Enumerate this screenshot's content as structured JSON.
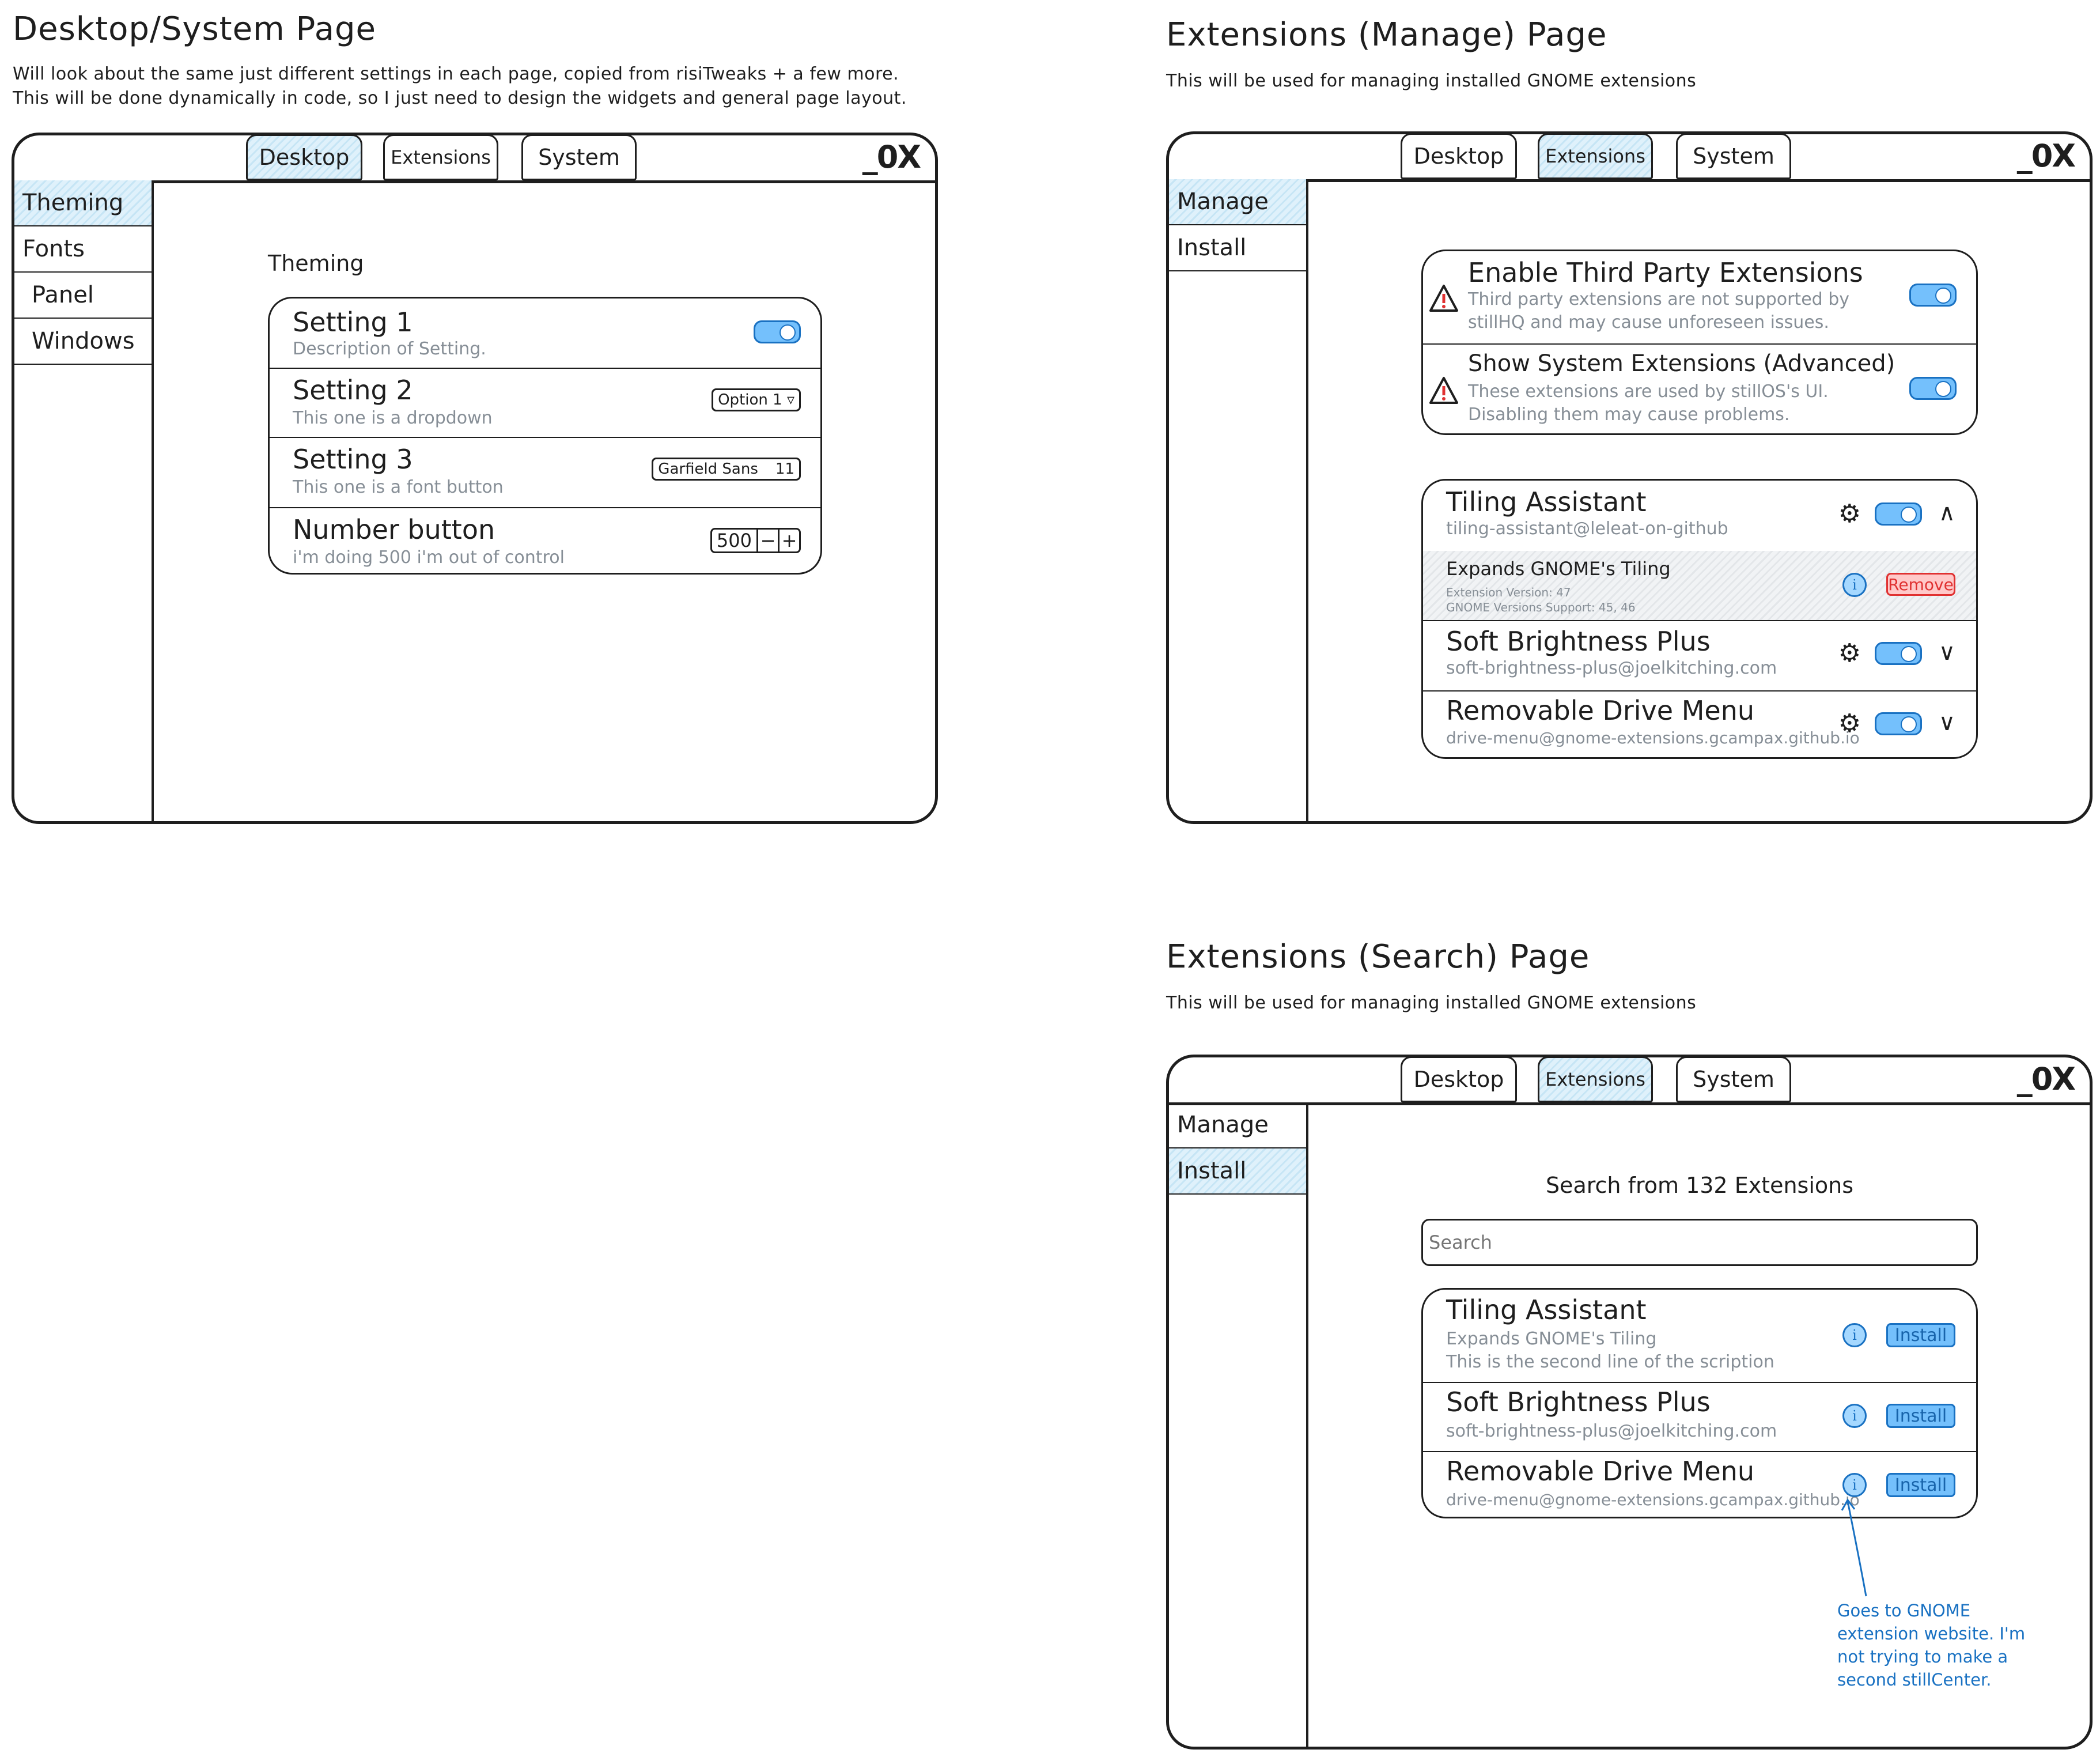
{
  "desktop": {
    "title": "Desktop/System Page",
    "desc1": "Will look about the same just different settings in each page, copied from risiTweaks + a few more.",
    "desc2": "This will be done dynamically in code, so I just need to design the widgets and general page layout.",
    "tabs": [
      "Desktop",
      "Extensions",
      "System"
    ],
    "window_controls": "_0X",
    "sidebar": [
      "Theming",
      "Fonts",
      "Panel",
      "Windows"
    ],
    "section_label": "Theming",
    "settings": [
      {
        "title": "Setting 1",
        "subtitle": "Description of Setting."
      },
      {
        "title": "Setting 2",
        "subtitle": "This one is a dropdown",
        "control": "Option 1 ▿"
      },
      {
        "title": "Setting 3",
        "subtitle": "This one is a font button",
        "font": "Garfield Sans",
        "size": "11"
      },
      {
        "title": "Number button",
        "subtitle": "i'm doing 500 i'm out of control",
        "value": "500",
        "minus": "−",
        "plus": "+"
      }
    ]
  },
  "manage": {
    "title": "Extensions (Manage) Page",
    "desc": "This will be used for managing installed GNOME extensions",
    "tabs": [
      "Desktop",
      "Extensions",
      "System"
    ],
    "window_controls": "_0X",
    "sidebar": [
      "Manage",
      "Install"
    ],
    "warnings": [
      {
        "title": "Enable Third Party Extensions",
        "line1": "Third party extensions are not supported by",
        "line2": "stillHQ and may cause unforeseen issues."
      },
      {
        "title": "Show System Extensions (Advanced)",
        "line1": "These extensions are used by stillOS's UI.",
        "line2": "Disabling them may cause problems."
      }
    ],
    "extensions": [
      {
        "name": "Tiling Assistant",
        "id": "tiling-assistant@leleat-on-github",
        "chevron": "∧"
      },
      {
        "name": "Soft Brightness Plus",
        "id": "soft-brightness-plus@joelkitching.com",
        "chevron": "∨"
      },
      {
        "name": "Removable Drive Menu",
        "id": "drive-menu@gnome-extensions.gcampax.github.io",
        "chevron": "∨"
      }
    ],
    "expanded": {
      "summary": "Expands GNOME's Tiling",
      "version": "Extension Version: 47",
      "support": "GNOME Versions Support: 45, 46",
      "remove": "Remove",
      "info": "i"
    }
  },
  "search": {
    "title": "Extensions (Search) Page",
    "desc": "This will be used for managing installed GNOME extensions",
    "tabs": [
      "Desktop",
      "Extensions",
      "System"
    ],
    "window_controls": "_0X",
    "sidebar": [
      "Manage",
      "Install"
    ],
    "heading": "Search from 132 Extensions",
    "search_placeholder": "Search",
    "results": [
      {
        "name": "Tiling Assistant",
        "line1": "Expands GNOME's Tiling",
        "line2": "This is the second line of the scription"
      },
      {
        "name": "Soft Brightness Plus",
        "line1": "soft-brightness-plus@joelkitching.com"
      },
      {
        "name": "Removable Drive Menu",
        "line1": "drive-menu@gnome-extensions.gcampax.github.io"
      }
    ],
    "install_label": "Install",
    "info": "i",
    "annotation": [
      "Goes to GNOME",
      "extension website. I'm",
      "not trying to make a",
      "second stillCenter."
    ]
  },
  "colors": {
    "accent": "#74c0fc",
    "accent_border": "#1971c2",
    "danger": "#e03131",
    "danger_fill": "#ffc9c9",
    "note_blue": "#1971c2",
    "muted": "#868e96"
  }
}
